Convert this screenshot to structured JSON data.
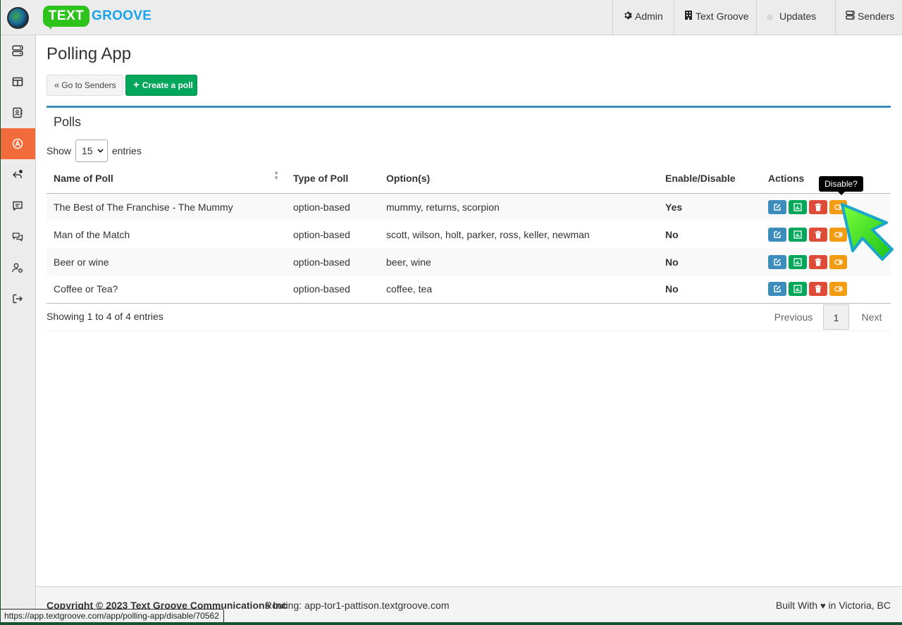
{
  "brand": {
    "part1": "TEXT",
    "part2": "GROOVE",
    "color_green": "#2ec21d",
    "color_blue": "#1aa3e8"
  },
  "topnav": {
    "admin": "Admin",
    "textgroove": "Text Groove",
    "updates": "Updates",
    "senders": "Senders"
  },
  "sidebar": {
    "items": [
      {
        "icon": "database-icon"
      },
      {
        "icon": "layout-icon"
      },
      {
        "icon": "contacts-icon"
      },
      {
        "icon": "poll-app-icon",
        "active": true
      },
      {
        "icon": "reply-settings-icon"
      },
      {
        "icon": "message-icon"
      },
      {
        "icon": "chat-icon"
      },
      {
        "icon": "user-settings-icon"
      },
      {
        "icon": "logout-icon"
      }
    ],
    "active_color": "#f26b3a"
  },
  "page": {
    "title": "Polling App",
    "go_to_senders": "Go to Senders",
    "create_poll": "Create a poll"
  },
  "polls": {
    "box_title": "Polls",
    "show_label": "Show",
    "entries_value": "15",
    "entries_label": "entries",
    "columns": [
      "Name of Poll",
      "Type of Poll",
      "Option(s)",
      "Enable/Disable",
      "Actions"
    ],
    "rows": [
      {
        "name": "The Best of The Franchise - The Mummy",
        "type": "option-based",
        "options": "mummy, returns, scorpion",
        "enabled": "Yes"
      },
      {
        "name": "Man of the Match",
        "type": "option-based",
        "options": "scott, wilson, holt, parker, ross, keller, newman",
        "enabled": "No"
      },
      {
        "name": "Beer or wine",
        "type": "option-based",
        "options": "beer, wine",
        "enabled": "No"
      },
      {
        "name": "Coffee or Tea?",
        "type": "option-based",
        "options": "coffee, tea",
        "enabled": "No"
      }
    ],
    "info": "Showing 1 to 4 of 4 entries",
    "pager": {
      "previous": "Previous",
      "current": "1",
      "next": "Next"
    },
    "tooltip": "Disable?"
  },
  "footer": {
    "copyright": "Copyright © 2023 Text Groove Communications Inc",
    "routing": "Routing: app-tor1-pattison.textgroove.com",
    "built_prefix": "Built With",
    "built_suffix": "in Victoria, BC"
  },
  "status_bar": {
    "url": "https://app.textgroove.com/app/polling-app/disable/70562"
  }
}
